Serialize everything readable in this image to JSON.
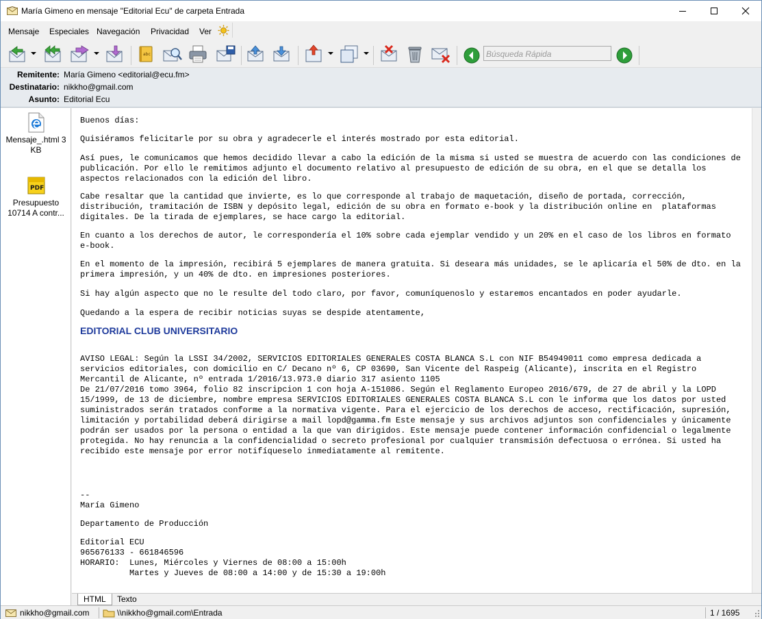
{
  "window": {
    "title": "María Gimeno en mensaje \"Editorial Ecu\" de carpeta Entrada"
  },
  "menu": {
    "items": [
      {
        "label": "Mensaje"
      },
      {
        "label": "Especiales"
      },
      {
        "label": "Navegación"
      },
      {
        "label": "Privacidad"
      },
      {
        "label": "Ver"
      }
    ]
  },
  "toolbar": {
    "search_placeholder": "Búsqueda Rápida",
    "icons": [
      "reply-icon",
      "reply-all-icon",
      "forward-icon",
      "redirect-icon",
      "spellcheck-icon",
      "preview-icon",
      "print-icon",
      "save-icon",
      "previous-message-icon",
      "next-message-icon",
      "export-icon",
      "copy-icon",
      "delete-mark-icon",
      "trash-icon",
      "spam-icon",
      "back-green-icon",
      "forward-green-icon"
    ]
  },
  "header": {
    "from_label": "Remitente:",
    "from_value": "María Gimeno <editorial@ecu.fm>",
    "to_label": "Destinatario:",
    "to_value": "nikkho@gmail.com",
    "subject_label": "Asunto:",
    "subject_value": "Editorial Ecu"
  },
  "attachments": [
    {
      "name": "Mensaje_.html 3 KB",
      "line1": "Mensaje_.html 3",
      "line2": "KB",
      "icon": "edge-html-icon"
    },
    {
      "name": "Presupuesto 10714 A contr...",
      "line1": "Presupuesto",
      "line2": "10714 A contr...",
      "icon": "pdf-icon"
    }
  ],
  "message": {
    "greeting": "Buenos días:",
    "p1": "Quisiéramos felicitarle por su obra y agradecerle el interés mostrado por esta editorial.",
    "p2": "Así pues, le comunicamos que hemos decidido llevar a cabo la edición de la misma si usted se muestra de acuerdo con las condiciones de publicación. Por ello le remitimos adjunto el documento relativo al presupuesto de edición de su obra, en el que se detalla los aspectos relacionados con la edición del libro.",
    "p3": "Cabe resaltar que la cantidad que invierte, es lo que corresponde al trabajo de maquetación, diseño de portada, corrección, distribución, tramitación de ISBN y depósito legal, edición de su obra en formato e-book y la distribución online en  plataformas digitales. De la tirada de ejemplares, se hace cargo la editorial.",
    "p4": "En cuanto a los derechos de autor, le correspondería el 10% sobre cada ejemplar vendido y un 20% en el caso de los libros en formato e-book.",
    "p5": "En el momento de la impresión, recibirá 5 ejemplares de manera gratuita. Si deseara más unidades, se le aplicaría el 50% de dto. en la primera impresión, y un 40% de dto. en impresiones posteriores.",
    "p6": "Si hay algún aspecto que no le resulte del todo claro, por favor, comuníquenoslo y estaremos encantados en poder ayudarle.",
    "p7": "Quedando a la espera de recibir noticias suyas se despide atentamente,",
    "company": "EDITORIAL CLUB UNIVERSITARIO",
    "legal_1": "AVISO LEGAL: Según la LSSI 34/2002, SERVICIOS EDITORIALES GENERALES COSTA BLANCA S.L con NIF B54949011 como empresa dedicada a servicios editoriales, con domicilio en C/ Decano nº 6, CP 03690, San Vicente del Raspeig (Alicante), inscrita en el Registro Mercantil de Alicante, nº entrada 1/2016/13.973.0 diario 317 asiento 1105",
    "legal_2": "De 21/07/2016 tomo 3964, folio 82 inscripcion 1 con hoja A-151086. Según el Reglamento Europeo 2016/679, de 27 de abril y la LOPD 15/1999, de 13 de diciembre, nombre empresa SERVICIOS EDITORIALES GENERALES COSTA BLANCA S.L con le informa que los datos por usted suministrados serán tratados conforme a la normativa vigente. Para el ejercicio de los derechos de acceso, rectificación, supresión, limitación y portabilidad deberá dirigirse a mail lopd@gamma.fm Este mensaje y sus archivos adjuntos son confidenciales y únicamente podrán ser usados por la persona o entidad a la que van dirigidos. Este mensaje puede contener información confidencial o legalmente protegida. No hay renuncia a la confidencialidad o secreto profesional por cualquier transmisión defectuosa o errónea. Si usted ha recibido este mensaje por error notifíqueselo inmediatamente al remitente.",
    "sig_dash": "--",
    "sig_name": "María Gimeno",
    "sig_dept": "Departamento de Producción",
    "sig_org": "Editorial ECU",
    "sig_phone": "965676133 - 661846596",
    "sig_hours_1": "HORARIO:  Lunes, Miércoles y Viernes de 08:00 a 15:00h",
    "sig_hours_2": "          Martes y Jueves de 08:00 a 14:00 y de 15:30 a 19:00h"
  },
  "tabs": [
    {
      "label": "HTML",
      "active": true
    },
    {
      "label": "Texto",
      "active": false
    }
  ],
  "status": {
    "account": "nikkho@gmail.com",
    "folder": "\\\\nikkho@gmail.com\\Entrada",
    "position": "1 / 1695"
  },
  "colors": {
    "company_heading": "#1f3b9c",
    "header_background": "#e7ebef",
    "nav_green": "#2e9e3a"
  }
}
